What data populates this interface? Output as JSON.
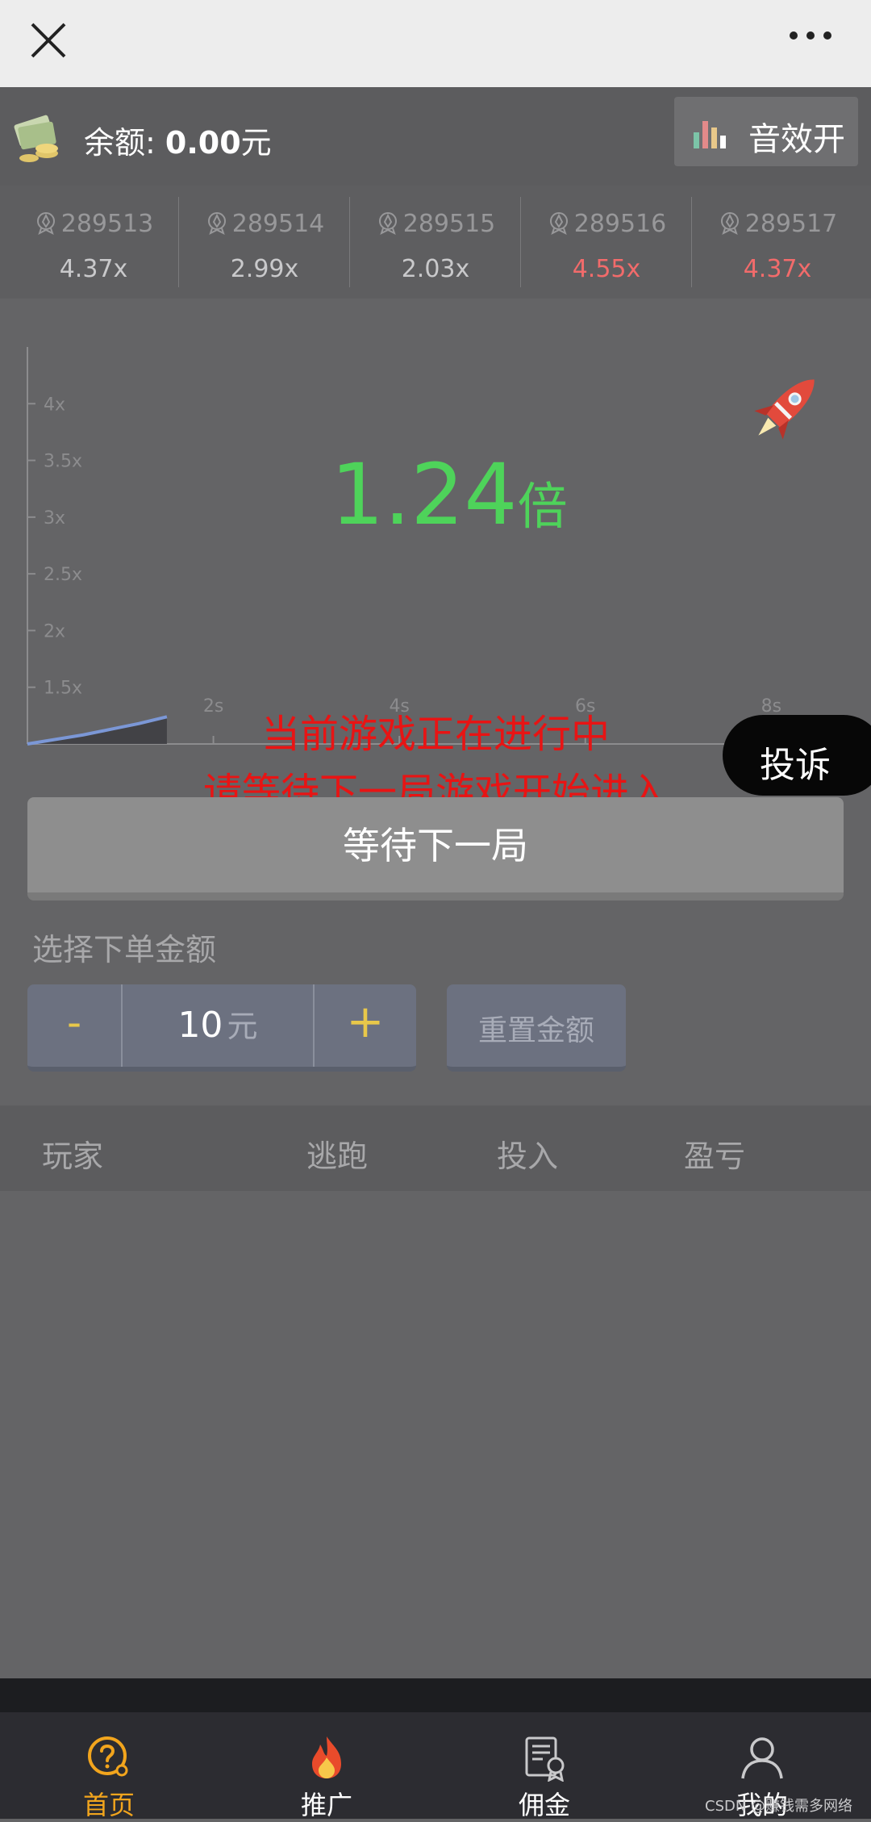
{
  "balance": {
    "label": "余额: ",
    "value": "0.00",
    "unit": "元"
  },
  "sound": {
    "label": "音效开"
  },
  "history": [
    {
      "round": "289513",
      "multiplier": "4.37x",
      "color": "#c9c9cb"
    },
    {
      "round": "289514",
      "multiplier": "2.99x",
      "color": "#c9c9cb"
    },
    {
      "round": "289515",
      "multiplier": "2.03x",
      "color": "#c9c9cb"
    },
    {
      "round": "289516",
      "multiplier": "4.55x",
      "color": "#f26b6b"
    },
    {
      "round": "289517",
      "multiplier": "4.37x",
      "color": "#f26b6b"
    }
  ],
  "game": {
    "multiplier": "1.24",
    "multiplier_unit": "倍",
    "notice_line1": "当前游戏正在进行中",
    "notice_line2": "请等待下一局游戏开始进入",
    "wait_button": "等待下一局",
    "complain_button": "投诉"
  },
  "chart_data": {
    "type": "area",
    "y_ticks": [
      "1.5x",
      "2x",
      "2.5x",
      "3x",
      "3.5x",
      "4x"
    ],
    "x_ticks": [
      "2s",
      "4s",
      "6s",
      "8s"
    ],
    "ylim": [
      1,
      4.5
    ],
    "xlim": [
      0,
      8.5
    ],
    "series": [
      {
        "x": [
          0,
          0.3,
          0.6,
          0.9,
          1.2,
          1.5
        ],
        "y": [
          1.0,
          1.04,
          1.08,
          1.13,
          1.18,
          1.24
        ]
      }
    ],
    "line_color": "#7b97d6"
  },
  "bet": {
    "title": "选择下单金额",
    "minus": "-",
    "value": "10",
    "unit": "元",
    "plus": "+",
    "reset": "重置金额"
  },
  "table": {
    "headers": [
      "玩家",
      "逃跑",
      "投入",
      "盈亏"
    ]
  },
  "tabs": [
    {
      "label": "首页",
      "icon": "home-help-icon",
      "active": true
    },
    {
      "label": "推广",
      "icon": "fire-icon",
      "active": false
    },
    {
      "label": "佣金",
      "icon": "certificate-icon",
      "active": false
    },
    {
      "label": "我的",
      "icon": "user-icon",
      "active": false
    }
  ],
  "watermark": "CSDN @赚钱需多网络"
}
